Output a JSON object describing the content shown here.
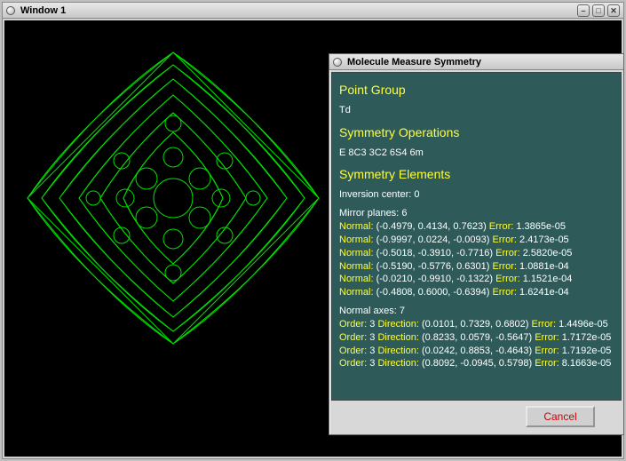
{
  "main_window": {
    "title": "Window 1"
  },
  "dialog": {
    "title": "Molecule Measure Symmetry",
    "headings": {
      "point_group": "Point Group",
      "symmetry_ops": "Symmetry Operations",
      "symmetry_elems": "Symmetry Elements"
    },
    "point_group_value": "Td",
    "symmetry_ops_value": "E 8C3 3C2 6S4 6m",
    "inversion_label": "Inversion center:",
    "inversion_value": "0",
    "mirror_label": "Mirror planes:",
    "mirror_count": "6",
    "normal_label": "Normal:",
    "error_label": "Error:",
    "mirrors": [
      {
        "normal": "(-0.4979, 0.4134, 0.7623)",
        "error": "1.3865e-05"
      },
      {
        "normal": "(-0.9997, 0.0224, -0.0093)",
        "error": "2.4173e-05"
      },
      {
        "normal": "(-0.5018, -0.3910, -0.7716)",
        "error": "2.5820e-05"
      },
      {
        "normal": "(-0.5190, -0.5776, 0.6301)",
        "error": "1.0881e-04"
      },
      {
        "normal": "(-0.0210, -0.9910, -0.1322)",
        "error": "1.1521e-04"
      },
      {
        "normal": "(-0.4808, 0.6000, -0.6394)",
        "error": "1.6241e-04"
      }
    ],
    "axes_label": "Normal axes:",
    "axes_count": "7",
    "order_label": "Order:",
    "direction_label": "Direction:",
    "axes": [
      {
        "order": "3",
        "direction": "(0.0101, 0.7329, 0.6802)",
        "error": "1.4496e-05"
      },
      {
        "order": "3",
        "direction": "(0.8233, 0.0579, -0.5647)",
        "error": "1.7172e-05"
      },
      {
        "order": "3",
        "direction": "(0.0242, 0.8853, -0.4643)",
        "error": "1.7192e-05"
      },
      {
        "order": "3",
        "direction": "(0.8092, -0.0945, 0.5798)",
        "error": "8.1663e-05"
      }
    ],
    "cancel_label": "Cancel"
  }
}
